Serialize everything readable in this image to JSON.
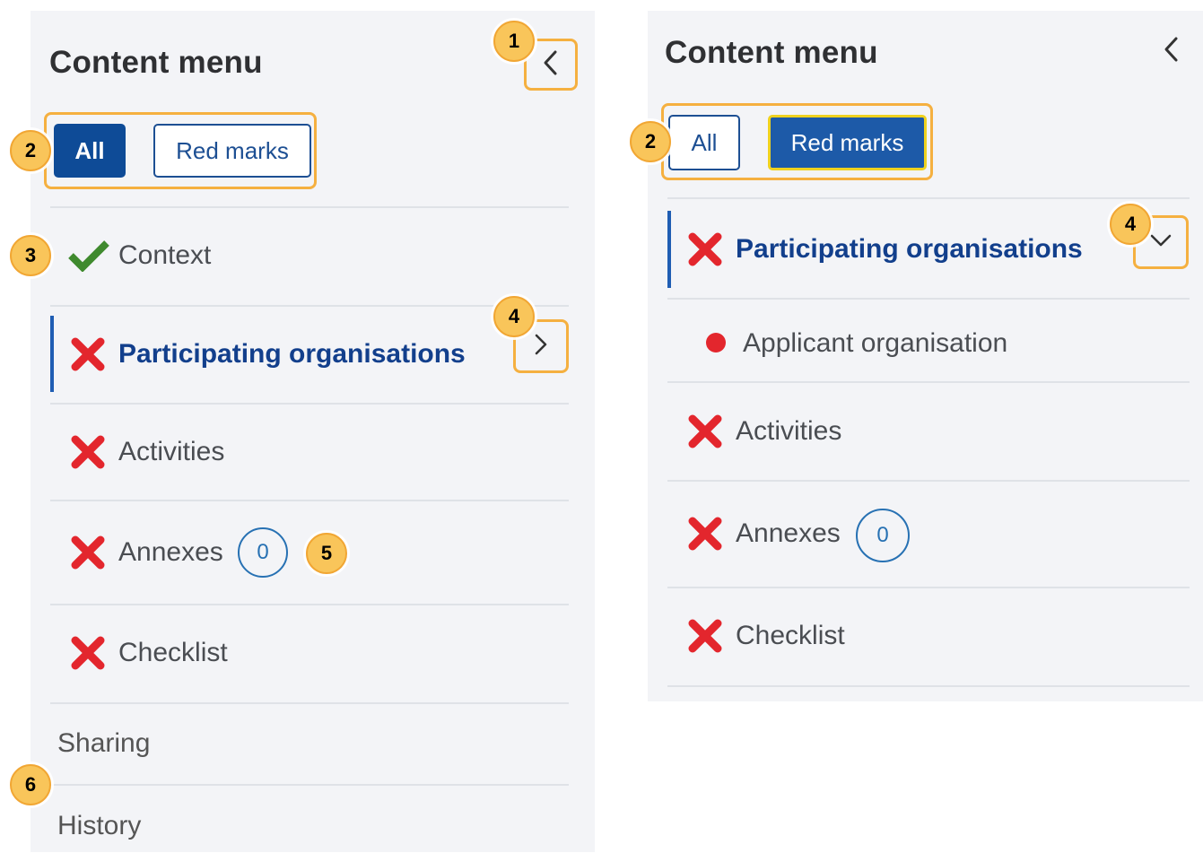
{
  "colors": {
    "accent": "#0e4b97",
    "highlight": "#f5b040",
    "callout": "#f9c55a",
    "error_red": "#e3262d",
    "success_green": "#3f8a2e",
    "badge_blue": "#2771b3"
  },
  "left_panel": {
    "title": "Content menu",
    "collapse_icon": "chevron-left-icon",
    "filters": {
      "all_label": "All",
      "red_marks_label": "Red marks",
      "selected": "All"
    },
    "items": [
      {
        "label": "Context",
        "status": "complete",
        "icon": "checkmark-icon"
      },
      {
        "label": "Participating organisations",
        "status": "error",
        "icon": "cross-icon",
        "active": true,
        "expand_icon": "chevron-right-icon"
      },
      {
        "label": "Activities",
        "status": "error",
        "icon": "cross-icon"
      },
      {
        "label": "Annexes",
        "status": "error",
        "icon": "cross-icon",
        "count": "0"
      },
      {
        "label": "Checklist",
        "status": "error",
        "icon": "cross-icon"
      }
    ],
    "extra_items": [
      {
        "label": "Sharing"
      },
      {
        "label": "History"
      }
    ]
  },
  "right_panel": {
    "title": "Content menu",
    "collapse_icon": "chevron-left-icon",
    "filters": {
      "all_label": "All",
      "red_marks_label": "Red marks",
      "selected": "Red marks"
    },
    "items": [
      {
        "label": "Participating organisations",
        "status": "error",
        "icon": "cross-icon",
        "active": true,
        "expand_icon": "chevron-down-icon"
      },
      {
        "label": "Applicant organisation",
        "status": "error",
        "icon": "red-dot-icon",
        "sub": true
      },
      {
        "label": "Activities",
        "status": "error",
        "icon": "cross-icon"
      },
      {
        "label": "Annexes",
        "status": "error",
        "icon": "cross-icon",
        "count": "0"
      },
      {
        "label": "Checklist",
        "status": "error",
        "icon": "cross-icon"
      }
    ]
  },
  "callouts": {
    "c1": "1",
    "c2_left": "2",
    "c3": "3",
    "c4_left": "4",
    "c5": "5",
    "c6": "6",
    "c2_right": "2",
    "c4_right": "4"
  }
}
